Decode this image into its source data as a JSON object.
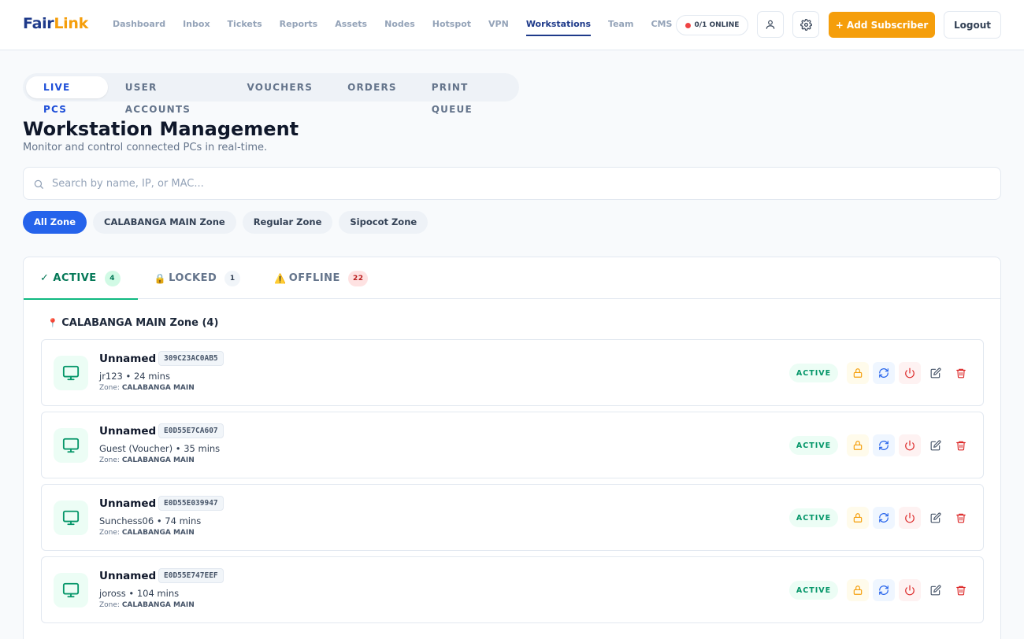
{
  "brand": {
    "part1": "Fair",
    "part2": "Link"
  },
  "nav": [
    {
      "label": "Dashboard",
      "active": false
    },
    {
      "label": "Inbox",
      "active": false
    },
    {
      "label": "Tickets",
      "active": false
    },
    {
      "label": "Reports",
      "active": false
    },
    {
      "label": "Assets",
      "active": false
    },
    {
      "label": "Nodes",
      "active": false
    },
    {
      "label": "Hotspot",
      "active": false
    },
    {
      "label": "VPN",
      "active": false
    },
    {
      "label": "Workstations",
      "active": true
    },
    {
      "label": "Team",
      "active": false
    },
    {
      "label": "CMS",
      "active": false
    }
  ],
  "header": {
    "online_status": "0/1 ONLINE",
    "profile_icon": "user-icon",
    "settings_icon": "gear-icon",
    "add_button": "+ Add Subscriber",
    "logout_button": "Logout"
  },
  "subtabs": [
    {
      "label": "LIVE PCS",
      "active": true
    },
    {
      "label": "USER ACCOUNTS",
      "active": false
    },
    {
      "label": "VOUCHERS",
      "active": false
    },
    {
      "label": "ORDERS",
      "active": false
    },
    {
      "label": "PRINT QUEUE",
      "active": false
    }
  ],
  "page": {
    "title": "Workstation Management",
    "subtitle": "Monitor and control connected PCs in real-time."
  },
  "search": {
    "placeholder": "Search by name, IP, or MAC...",
    "value": ""
  },
  "zones": [
    {
      "label": "All Zone",
      "active": true
    },
    {
      "label": "CALABANGA MAIN Zone",
      "active": false
    },
    {
      "label": "Regular Zone",
      "active": false
    },
    {
      "label": "Sipocot Zone",
      "active": false
    }
  ],
  "status_tabs": [
    {
      "prefix": "✓",
      "label": "ACTIVE",
      "count": "4",
      "active": true
    },
    {
      "prefix": "🔒",
      "label": "LOCKED",
      "count": "1",
      "active": false
    },
    {
      "prefix": "⚠️",
      "label": "OFFLINE",
      "count": "22",
      "active": false
    }
  ],
  "group": {
    "icon": "📍",
    "title": "CALABANGA MAIN Zone (4)"
  },
  "zone_label": "Zone:",
  "workstations": [
    {
      "name": "Unnamed",
      "mac": "309C23AC0AB5",
      "user_info": "jr123 • 24 mins",
      "zone": "CALABANGA MAIN",
      "status": "ACTIVE"
    },
    {
      "name": "Unnamed",
      "mac": "E0D55E7CA607",
      "user_info": "Guest (Voucher) • 35 mins",
      "zone": "CALABANGA MAIN",
      "status": "ACTIVE"
    },
    {
      "name": "Unnamed",
      "mac": "E0D55E039947",
      "user_info": "Sunchess06 • 74 mins",
      "zone": "CALABANGA MAIN",
      "status": "ACTIVE"
    },
    {
      "name": "Unnamed",
      "mac": "E0D55E747EEF",
      "user_info": "joross • 104 mins",
      "zone": "CALABANGA MAIN",
      "status": "ACTIVE"
    }
  ],
  "colors": {
    "brand_blue": "#1e3a8a",
    "brand_orange": "#f59e0b",
    "accent": "#2563eb",
    "active_green": "#059669",
    "danger": "#dc2626"
  }
}
